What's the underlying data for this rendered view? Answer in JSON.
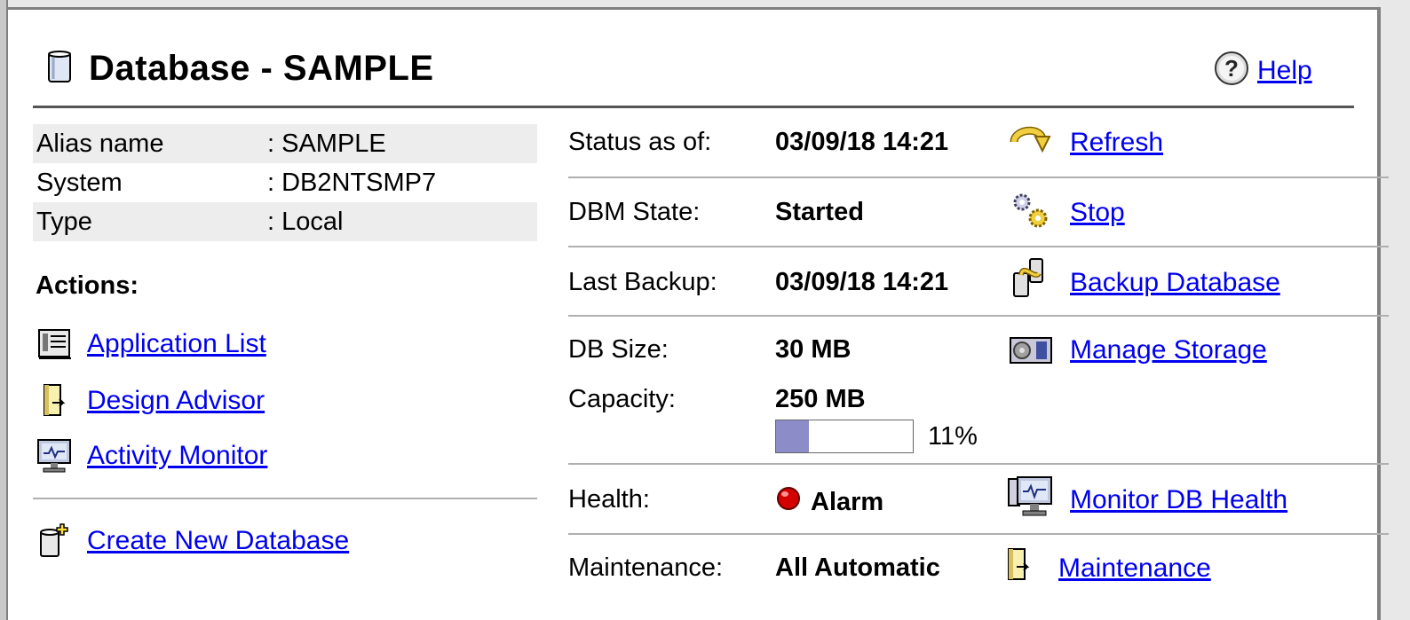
{
  "header": {
    "title": "Database - SAMPLE",
    "help_label": "Help"
  },
  "info": {
    "rows": [
      {
        "label": "Alias name",
        "value": ": SAMPLE"
      },
      {
        "label": "System",
        "value": ": DB2NTSMP7"
      },
      {
        "label": "Type",
        "value": ": Local"
      }
    ]
  },
  "actions": {
    "heading": "Actions:",
    "items": [
      {
        "label": "Application List",
        "icon": "application-list-icon"
      },
      {
        "label": "Design Advisor",
        "icon": "design-advisor-icon"
      },
      {
        "label": "Activity Monitor",
        "icon": "activity-monitor-icon"
      }
    ],
    "create_label": "Create New Database"
  },
  "status": {
    "status_label": "Status as of:",
    "status_value": "03/09/18 14:21",
    "refresh_label": "Refresh",
    "dbm_label": "DBM State:",
    "dbm_value": "Started",
    "stop_label": "Stop",
    "backup_label": "Last Backup:",
    "backup_value": "03/09/18 14:21",
    "backup_link": "Backup Database",
    "size_label": "DB Size:",
    "size_value": "30 MB",
    "storage_link": "Manage Storage",
    "capacity_label": "Capacity:",
    "capacity_value": "250 MB",
    "capacity_percent": 11,
    "capacity_percent_text": "11%",
    "health_label": "Health:",
    "health_value": "Alarm",
    "health_color": "#d40000",
    "health_link": "Monitor DB Health",
    "maint_label": "Maintenance:",
    "maint_value": "All Automatic",
    "maint_link": "Maintenance"
  },
  "colors": {
    "link": "#0000ee",
    "bar_fill": "#8c8cc8",
    "row_shade": "#ededed"
  }
}
